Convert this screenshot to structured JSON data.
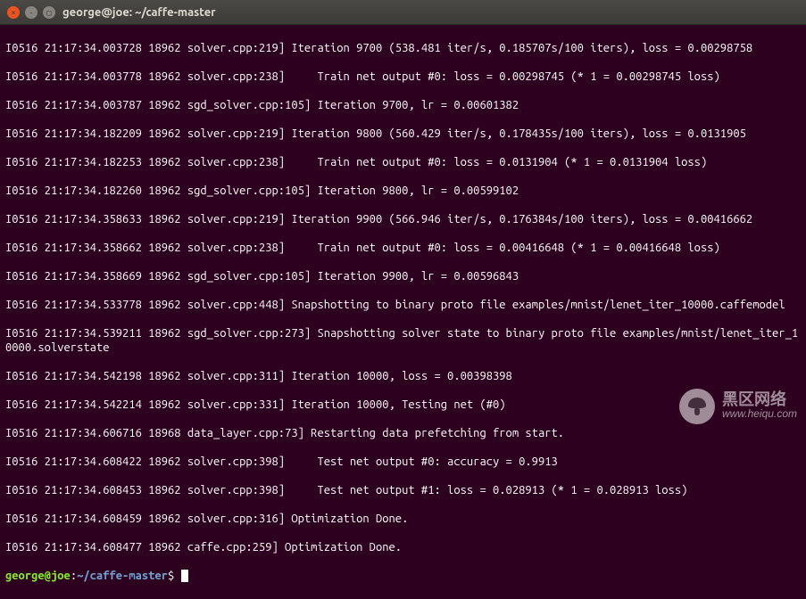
{
  "titlebar": {
    "title": "george@joe: ~/caffe-master"
  },
  "prompt": {
    "user_host": "george@joe",
    "separator": ":",
    "path": "~/caffe-master",
    "symbol": "$"
  },
  "lines": [
    "I0516 21:17:34.003728 18962 solver.cpp:219] Iteration 9700 (538.481 iter/s, 0.185707s/100 iters), loss = 0.00298758",
    "I0516 21:17:34.003778 18962 solver.cpp:238]     Train net output #0: loss = 0.00298745 (* 1 = 0.00298745 loss)",
    "I0516 21:17:34.003787 18962 sgd_solver.cpp:105] Iteration 9700, lr = 0.00601382",
    "I0516 21:17:34.182209 18962 solver.cpp:219] Iteration 9800 (560.429 iter/s, 0.178435s/100 iters), loss = 0.0131905",
    "I0516 21:17:34.182253 18962 solver.cpp:238]     Train net output #0: loss = 0.0131904 (* 1 = 0.0131904 loss)",
    "I0516 21:17:34.182260 18962 sgd_solver.cpp:105] Iteration 9800, lr = 0.00599102",
    "I0516 21:17:34.358633 18962 solver.cpp:219] Iteration 9900 (566.946 iter/s, 0.176384s/100 iters), loss = 0.00416662",
    "I0516 21:17:34.358662 18962 solver.cpp:238]     Train net output #0: loss = 0.00416648 (* 1 = 0.00416648 loss)",
    "I0516 21:17:34.358669 18962 sgd_solver.cpp:105] Iteration 9900, lr = 0.00596843",
    "I0516 21:17:34.533778 18962 solver.cpp:448] Snapshotting to binary proto file examples/mnist/lenet_iter_10000.caffemodel",
    "I0516 21:17:34.539211 18962 sgd_solver.cpp:273] Snapshotting solver state to binary proto file examples/mnist/lenet_iter_10000.solverstate",
    "I0516 21:17:34.542198 18962 solver.cpp:311] Iteration 10000, loss = 0.00398398",
    "I0516 21:17:34.542214 18962 solver.cpp:331] Iteration 10000, Testing net (#0)",
    "I0516 21:17:34.606716 18968 data_layer.cpp:73] Restarting data prefetching from start.",
    "I0516 21:17:34.608422 18962 solver.cpp:398]     Test net output #0: accuracy = 0.9913",
    "I0516 21:17:34.608453 18962 solver.cpp:398]     Test net output #1: loss = 0.028913 (* 1 = 0.028913 loss)",
    "I0516 21:17:34.608459 18962 solver.cpp:316] Optimization Done.",
    "I0516 21:17:34.608477 18962 caffe.cpp:259] Optimization Done."
  ],
  "watermark": {
    "title": "黑区网络",
    "url": "www.heiqu.com"
  }
}
